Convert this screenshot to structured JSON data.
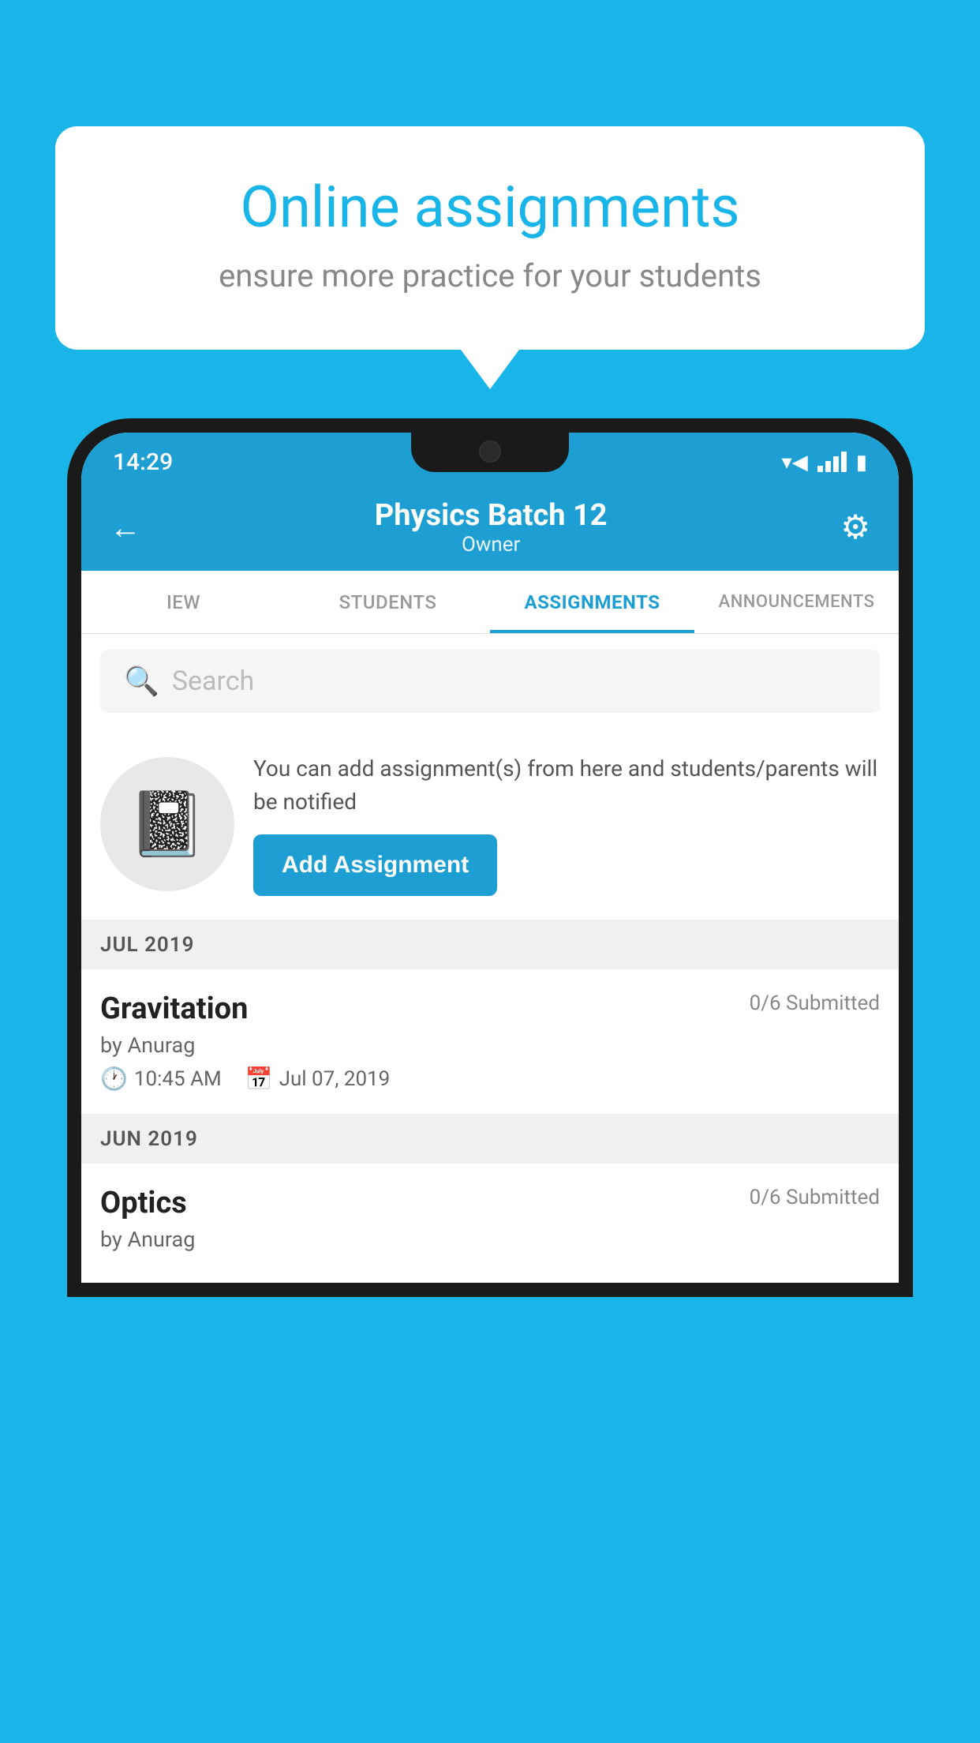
{
  "background_color": "#1ab5e8",
  "bubble": {
    "title": "Online assignments",
    "subtitle": "ensure more practice for your students"
  },
  "status_bar": {
    "time": "14:29",
    "wifi_icon": "▼",
    "battery_icon": "▮"
  },
  "header": {
    "title": "Physics Batch 12",
    "subtitle": "Owner",
    "back_label": "←",
    "settings_label": "⚙"
  },
  "tabs": [
    {
      "label": "IEW",
      "active": false
    },
    {
      "label": "STUDENTS",
      "active": false
    },
    {
      "label": "ASSIGNMENTS",
      "active": true
    },
    {
      "label": "ANNOUNCEMENTS",
      "active": false
    }
  ],
  "search": {
    "placeholder": "Search"
  },
  "promo": {
    "text": "You can add assignment(s) from here and students/parents will be notified",
    "button_label": "Add Assignment"
  },
  "sections": [
    {
      "label": "JUL 2019",
      "assignments": [
        {
          "name": "Gravitation",
          "submitted": "0/6 Submitted",
          "by": "by Anurag",
          "time": "10:45 AM",
          "date": "Jul 07, 2019"
        }
      ]
    },
    {
      "label": "JUN 2019",
      "assignments": [
        {
          "name": "Optics",
          "submitted": "0/6 Submitted",
          "by": "by Anurag",
          "time": "",
          "date": ""
        }
      ]
    }
  ]
}
